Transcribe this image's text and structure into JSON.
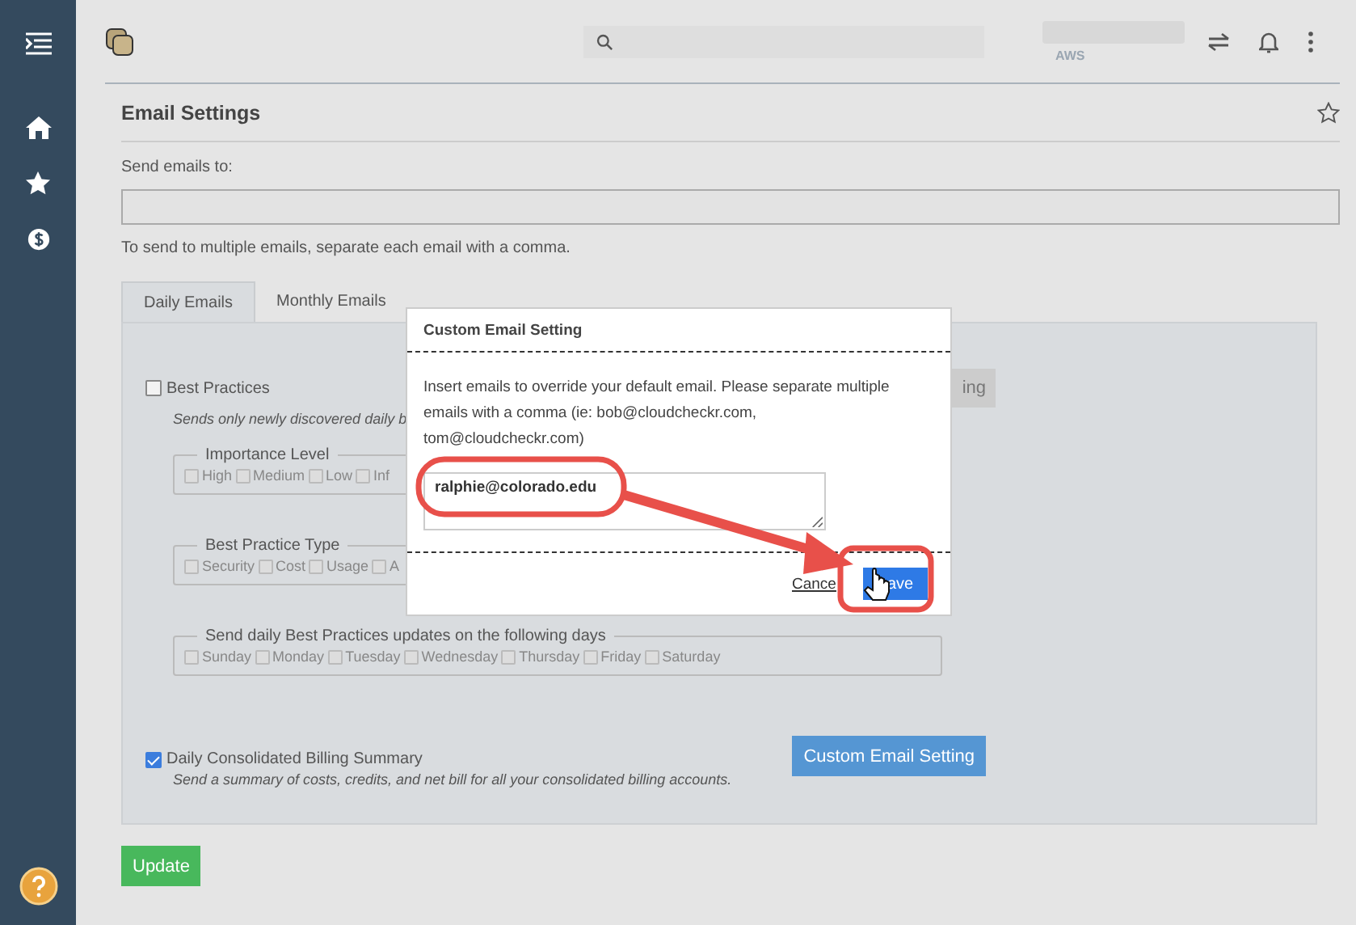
{
  "header": {
    "account_label": "AWS"
  },
  "page": {
    "title": "Email Settings",
    "send_to_label": "Send emails to:",
    "hint": "To send to multiple emails, separate each email with a comma."
  },
  "tabs": [
    {
      "label": "Daily Emails",
      "selected": true
    },
    {
      "label": "Monthly Emails",
      "selected": false
    }
  ],
  "best_practices": {
    "label": "Best Practices",
    "checked": false,
    "description": "Sends only newly discovered daily b",
    "button": "ing",
    "groups": [
      {
        "legend": "Importance Level",
        "options": [
          {
            "label": "High",
            "checked": false
          },
          {
            "label": "Medium",
            "checked": false
          },
          {
            "label": "Low",
            "checked": false
          },
          {
            "label": "Inf",
            "checked": false
          }
        ]
      },
      {
        "legend": "Best Practice Type",
        "options": [
          {
            "label": "Security",
            "checked": false
          },
          {
            "label": "Cost",
            "checked": false
          },
          {
            "label": "Usage",
            "checked": false
          },
          {
            "label": "A",
            "checked": false
          }
        ]
      },
      {
        "legend": "Send daily Best Practices updates on the following days",
        "options": [
          {
            "label": "Sunday",
            "checked": false
          },
          {
            "label": "Monday",
            "checked": false
          },
          {
            "label": "Tuesday",
            "checked": false
          },
          {
            "label": "Wednesday",
            "checked": false
          },
          {
            "label": "Thursday",
            "checked": false
          },
          {
            "label": "Friday",
            "checked": false
          },
          {
            "label": "Saturday",
            "checked": false
          }
        ]
      }
    ]
  },
  "billing": {
    "label": "Daily Consolidated Billing Summary",
    "checked": true,
    "description": "Send a summary of costs, credits, and net bill for all your consolidated billing accounts.",
    "button": "Custom Email Setting"
  },
  "update_button": "Update",
  "dialog": {
    "title": "Custom Email Setting",
    "message": "Insert emails to override your default email. Please separate multiple emails with a comma (ie: bob@cloudcheckr.com, tom@cloudcheckr.com)",
    "value": "ralphie@colorado.edu",
    "cancel": "Cance",
    "save": "ave"
  }
}
